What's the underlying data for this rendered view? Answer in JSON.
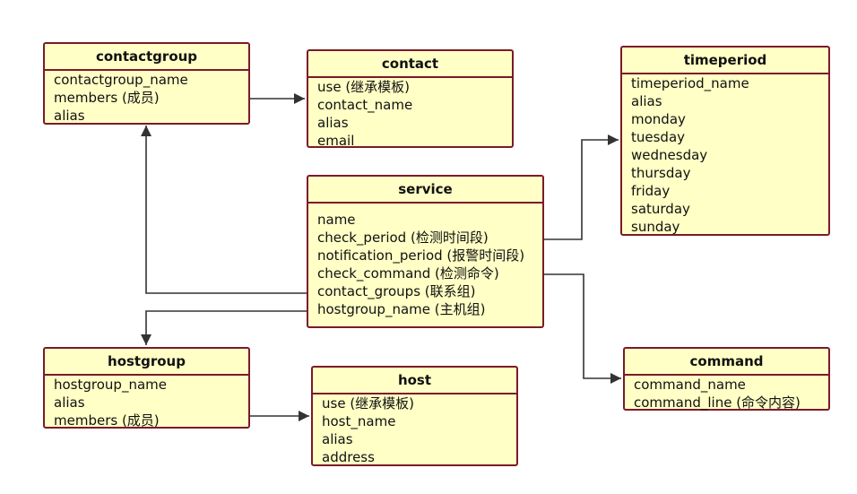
{
  "colors": {
    "fill": "#ffffc6",
    "border": "#7b1a2a",
    "line": "#333333"
  },
  "entities": {
    "contactgroup": {
      "title": "contactgroup",
      "fields": [
        "contactgroup_name",
        "members (成员)",
        "alias"
      ]
    },
    "contact": {
      "title": "contact",
      "fields": [
        "use (继承模板)",
        "contact_name",
        "alias",
        "email"
      ]
    },
    "timeperiod": {
      "title": "timeperiod",
      "fields": [
        "timeperiod_name",
        "alias",
        "monday",
        "tuesday",
        "wednesday",
        "thursday",
        "friday",
        "saturday",
        "sunday"
      ]
    },
    "service": {
      "title": "service",
      "fields": [
        "name",
        "check_period (检测时间段)",
        "notification_period (报警时间段)",
        "check_command (检测命令)",
        "contact_groups (联系组)",
        "hostgroup_name (主机组)"
      ]
    },
    "hostgroup": {
      "title": "hostgroup",
      "fields": [
        "hostgroup_name",
        "alias",
        "members (成员)"
      ]
    },
    "host": {
      "title": "host",
      "fields": [
        "use (继承模板)",
        "host_name",
        "alias",
        "address"
      ]
    },
    "command": {
      "title": "command",
      "fields": [
        "command_name",
        "command_line (命令内容)"
      ]
    }
  },
  "relationships": [
    {
      "from": "contactgroup",
      "to": "contact"
    },
    {
      "from": "service",
      "to": "timeperiod"
    },
    {
      "from": "service",
      "to": "command"
    },
    {
      "from": "service",
      "to": "contactgroup"
    },
    {
      "from": "service",
      "to": "hostgroup"
    },
    {
      "from": "hostgroup",
      "to": "host"
    }
  ]
}
